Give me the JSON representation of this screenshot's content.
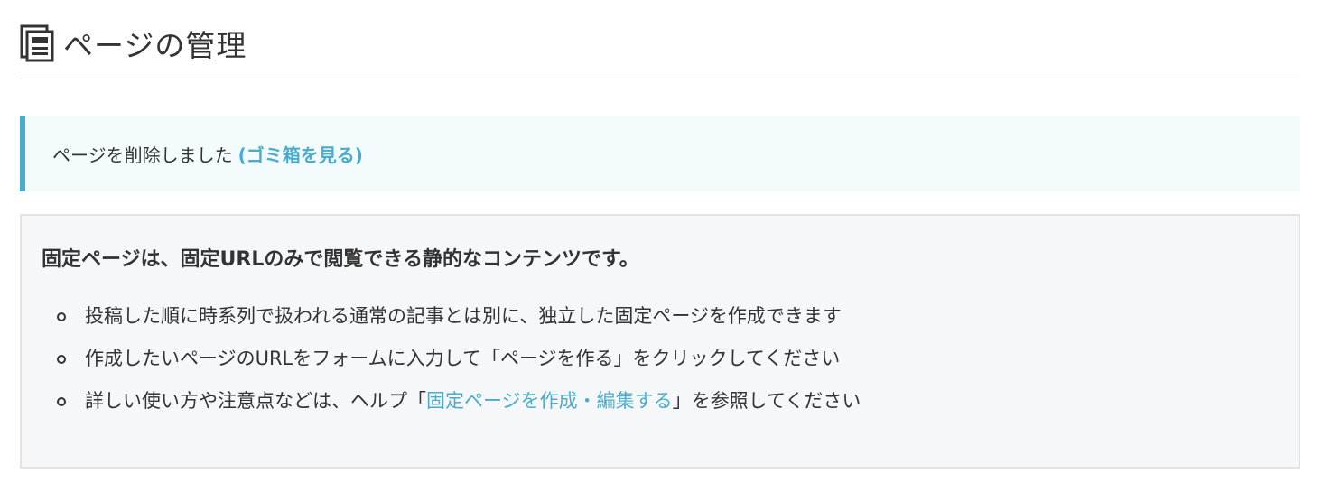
{
  "header": {
    "icon": "page-document-icon",
    "title": "ページの管理"
  },
  "notice": {
    "message": "ページを削除しました",
    "link_label": "(ゴミ箱を見る)",
    "accent_color": "#4aaccd"
  },
  "info": {
    "heading": "固定ページは、固定URLのみで閲覧できる静的なコンテンツです。",
    "items": [
      {
        "text": "投稿した順に時系列で扱われる通常の記事とは別に、独立した固定ページを作成できます"
      },
      {
        "text": "作成したいページのURLをフォームに入力して「ページを作る」をクリックしてください"
      },
      {
        "prefix": "詳しい使い方や注意点などは、ヘルプ「",
        "link_label": "固定ページを作成・編集する",
        "suffix": "」を参照してください"
      }
    ]
  },
  "colors": {
    "link": "#4aaccd",
    "text": "#333333",
    "notice_bg": "#f3fbfc",
    "info_bg": "#f6f7f9"
  }
}
